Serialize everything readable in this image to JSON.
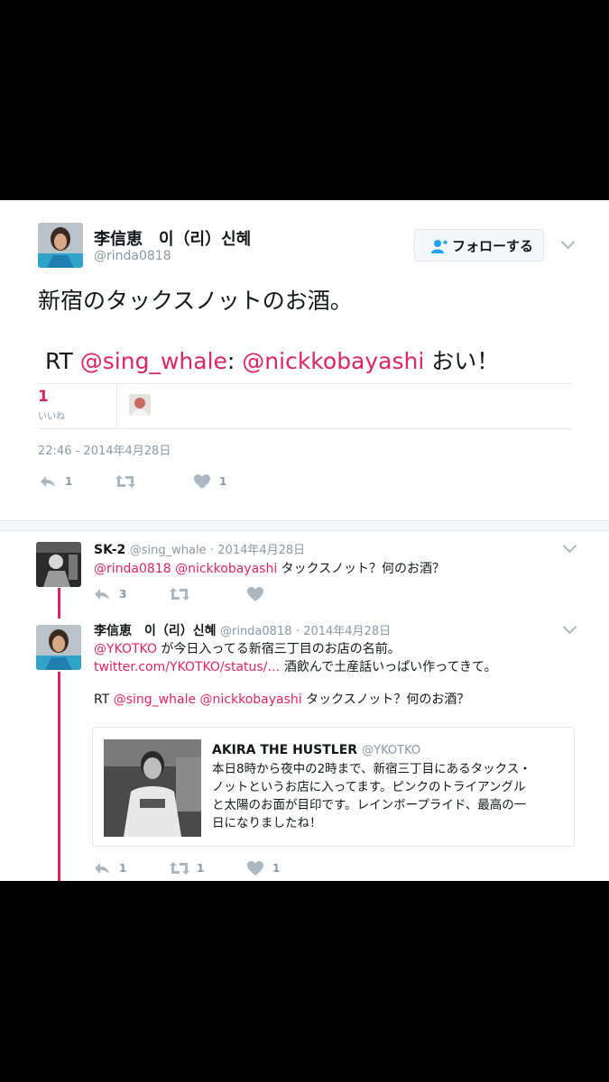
{
  "main_tweet": {
    "display_name": "李信恵　이（리）신혜",
    "handle": "@rinda0818",
    "follow_label": "フォローする",
    "text": "新宿のタックスノットのお酒。",
    "rt_prefix": "RT",
    "rt_mention1": "@sing_whale",
    "rt_colon": ":",
    "rt_mention2": "@nickkobayashi",
    "rt_suffix": "おい！",
    "likes_count": "1",
    "likes_label": "いいね",
    "timestamp": "22:46 - 2014年4月28日",
    "actions": {
      "reply_count": "1",
      "retweet_count": "",
      "like_count": "1"
    }
  },
  "reply1": {
    "display_name": "SK-2",
    "handle": "@sing_whale",
    "date": "· 2014年4月28日",
    "mention1": "@rinda0818",
    "mention2": "@nickkobayashi",
    "text": "タックスノット？何のお酒？",
    "actions": {
      "reply_count": "3",
      "retweet_count": "",
      "like_count": ""
    }
  },
  "reply2": {
    "display_name": "李信恵　이（리）신혜",
    "handle": "@rinda0818",
    "date": "· 2014年4月28日",
    "mention1": "@YKOTKO",
    "line1": "が今日入ってる新宿三丁目のお店の名前。",
    "link": "twitter.com/YKOTKO/status/…",
    "line2": "酒飲んで土産話いっぱい作ってきて。",
    "rt_prefix": "RT",
    "rt_mention1": "@sing_whale",
    "rt_mention2": "@nickkobayashi",
    "rt_text": "タックスノット？何のお酒？",
    "actions": {
      "reply_count": "1",
      "retweet_count": "1",
      "like_count": "1"
    }
  },
  "quoted": {
    "display_name": "AKIRA THE HUSTLER",
    "handle": "@YKOTKO",
    "line1": "本日8時から夜中の2時まで、新宿三丁目にあるタックス・",
    "line2": "ノットというお店に入ってます。ピンクのトライアングル",
    "line3": "と太陽のお面が目印です。レインボープライド、最高の一",
    "line4": "日になりましたね！"
  },
  "colors": {
    "accent": "#e0245e",
    "muted": "#8899a6",
    "border": "#e1e8ed",
    "link_blue": "#1da1f2"
  }
}
